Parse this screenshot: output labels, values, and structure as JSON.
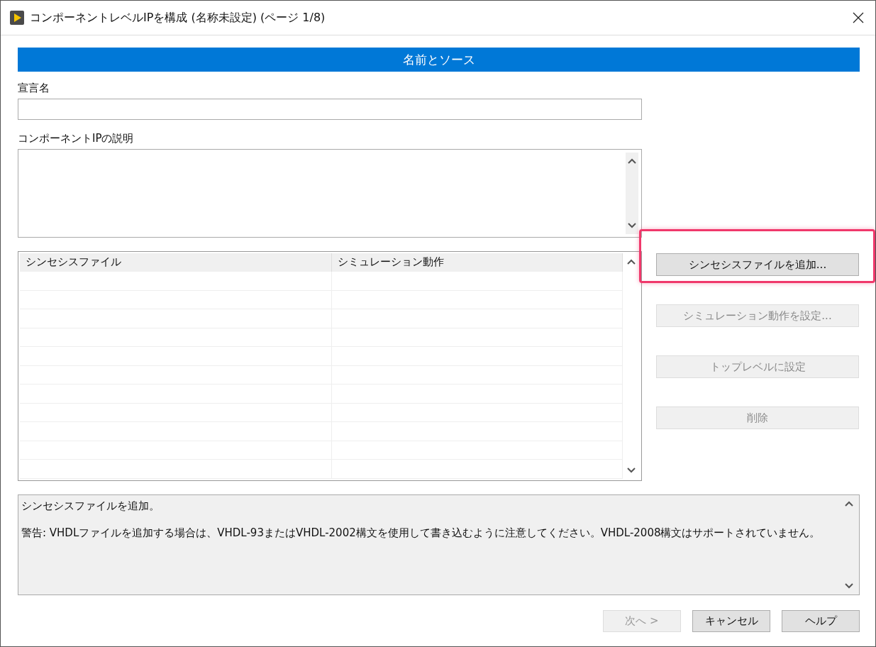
{
  "window": {
    "title": "コンポーネントレベルIPを構成 (名称未設定) (ページ 1/8)"
  },
  "section_header": "名前とソース",
  "declaration_name": {
    "label": "宣言名"
  },
  "description": {
    "label": "コンポーネントIPの説明"
  },
  "files_table": {
    "columns": [
      "シンセシスファイル",
      "シミュレーション動作"
    ]
  },
  "side_buttons": [
    {
      "label": "シンセシスファイルを追加...",
      "disabled": false,
      "highlighted": true
    },
    {
      "label": "シミュレーション動作を設定...",
      "disabled": true,
      "highlighted": false
    },
    {
      "label": "トップレベルに設定",
      "disabled": true,
      "highlighted": false
    },
    {
      "label": "削除",
      "disabled": true,
      "highlighted": false
    }
  ],
  "help_text": [
    "シンセシスファイルを追加。",
    "警告: VHDLファイルを追加する場合は、VHDL-93またはVHDL-2002構文を使用して書き込むように注意してください。VHDL-2008構文はサポートされていません。"
  ],
  "footer_buttons": [
    {
      "label": "次へ >",
      "disabled": true
    },
    {
      "label": "キャンセル",
      "disabled": false
    },
    {
      "label": "ヘルプ",
      "disabled": false
    }
  ]
}
